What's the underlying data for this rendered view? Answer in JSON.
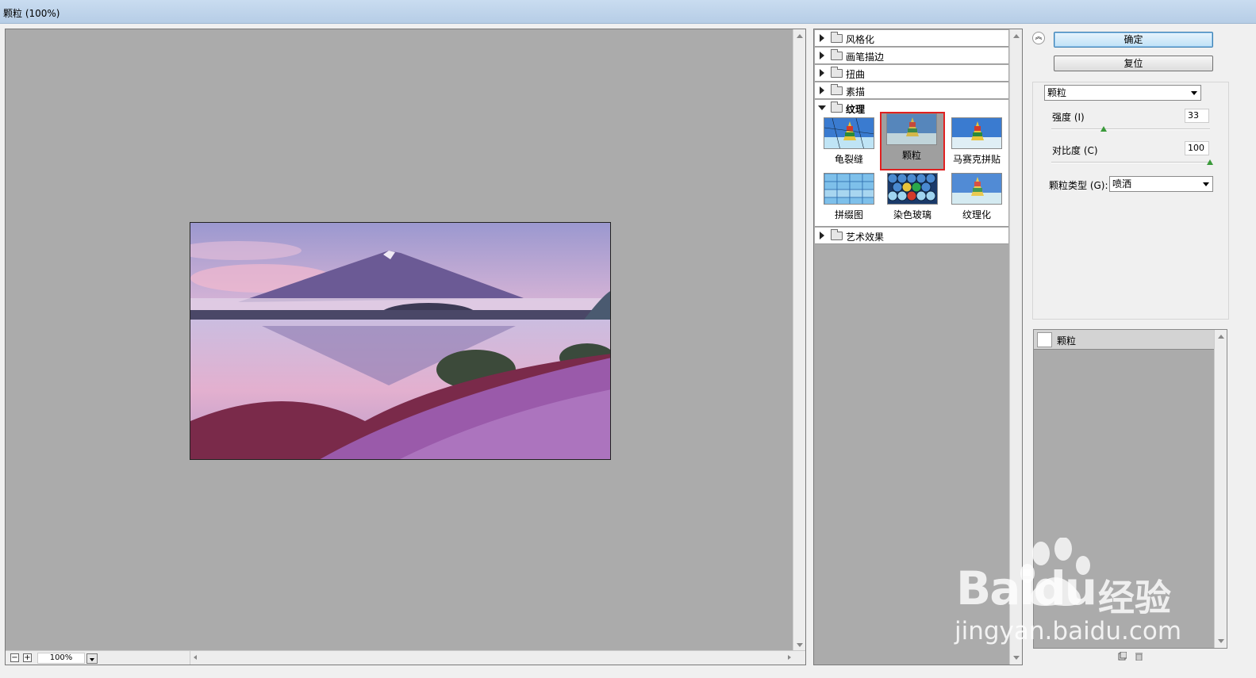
{
  "window": {
    "title": "颗粒 (100%)"
  },
  "preview": {
    "zoom": "100%"
  },
  "gallery": {
    "categories_top": [
      "风格化",
      "画笔描边",
      "扭曲",
      "素描"
    ],
    "active_category": "纹理",
    "thumbnails": [
      "龟裂缝",
      "颗粒",
      "马赛克拼贴",
      "拼缀图",
      "染色玻璃",
      "纹理化"
    ],
    "selected_thumbnail": "颗粒",
    "categories_bottom": [
      "艺术效果"
    ]
  },
  "buttons": {
    "ok": "确定",
    "reset": "复位"
  },
  "filter_select": "颗粒",
  "params": {
    "intensity": {
      "label": "强度 (I)",
      "value": "33",
      "fraction": 0.33
    },
    "contrast": {
      "label": "对比度 (C)",
      "value": "100",
      "fraction": 1.0
    },
    "grain_type": {
      "label": "颗粒类型 (G):",
      "value": "喷洒"
    }
  },
  "layers": {
    "item": "颗粒"
  },
  "watermark": {
    "brand": "Baidu",
    "brand_cn": "经验",
    "url": "jingyan.baidu.com"
  },
  "colors": {
    "selection_border": "#e02020",
    "ok_button": "#bfe1f7",
    "canvas_bg": "#ababab"
  },
  "icons": [
    "zoom-out-icon",
    "zoom-in-icon",
    "folder-icon",
    "collapse-icon",
    "new-layer-icon",
    "trash-icon"
  ]
}
